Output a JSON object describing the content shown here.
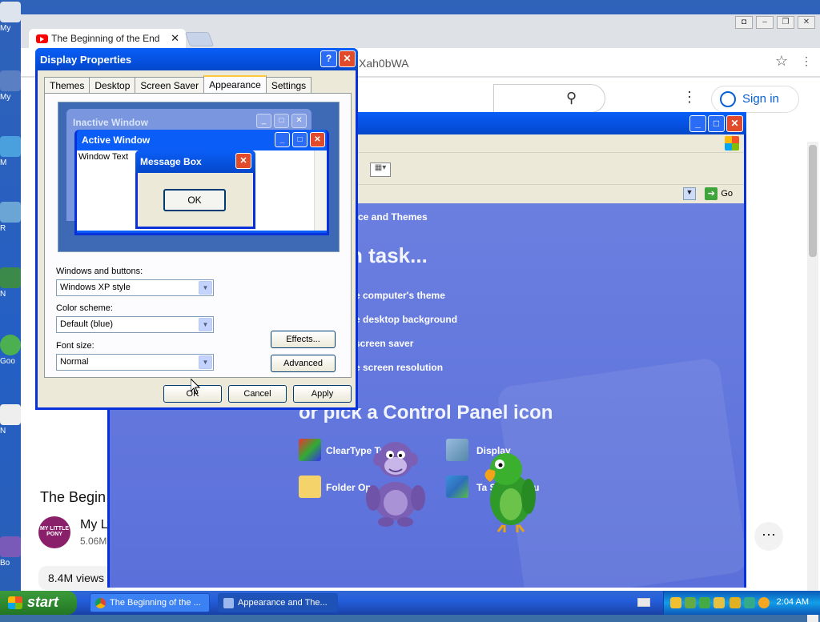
{
  "desktop": {
    "icons": [
      {
        "label": "My"
      },
      {
        "label": "My"
      },
      {
        "label": "M"
      },
      {
        "label": "R"
      },
      {
        "label": "N"
      },
      {
        "label": "Goo"
      },
      {
        "label": "N"
      },
      {
        "label": "Bo"
      }
    ]
  },
  "chrome": {
    "tab_title": "The Beginning of the End",
    "tab_close": "✕",
    "address": "Xah0bWA",
    "signin": "Sign in",
    "video_title": "The Begin",
    "channel_logo": "MY LITTLE PONY",
    "channel_name": "My L",
    "subscribers": "5.06M",
    "views": "8.4M views",
    "more": "···"
  },
  "control_panel": {
    "go_label": "Go",
    "breadcrumb": "ance and Themes",
    "pick_task": "n task...",
    "tasks": [
      "e computer's theme",
      "e desktop background",
      "screen saver",
      "e screen resolution"
    ],
    "pick_icon": "or pick a Control Panel icon",
    "icons": [
      {
        "label": "ClearType Tu"
      },
      {
        "label": "Display"
      },
      {
        "label": "Folder Op"
      },
      {
        "label": "Ta                   Start Menu"
      }
    ]
  },
  "display_properties": {
    "title": "Display Properties",
    "tabs": [
      "Themes",
      "Desktop",
      "Screen Saver",
      "Appearance",
      "Settings"
    ],
    "active_tab": "Appearance",
    "preview": {
      "inactive_title": "Inactive Window",
      "active_title": "Active Window",
      "window_text": "Window Text",
      "message_title": "Message Box",
      "message_ok": "OK"
    },
    "windows_buttons_label": "Windows and buttons:",
    "windows_buttons_value": "Windows XP style",
    "color_scheme_label": "Color scheme:",
    "color_scheme_value": "Default (blue)",
    "font_size_label": "Font size:",
    "font_size_value": "Normal",
    "effects_button": "Effects...",
    "advanced_button": "Advanced",
    "ok_button": "OK",
    "cancel_button": "Cancel",
    "apply_button": "Apply"
  },
  "taskbar": {
    "start_label": "start",
    "items": [
      "The Beginning of the ...",
      "Appearance and The..."
    ],
    "clock": "2:04 AM"
  },
  "colors": {
    "xp_blue": "#0a5ef7",
    "cp_background": "#6b7fe0",
    "taskbar": "#245edb",
    "start_green": "#2f8a2f"
  }
}
